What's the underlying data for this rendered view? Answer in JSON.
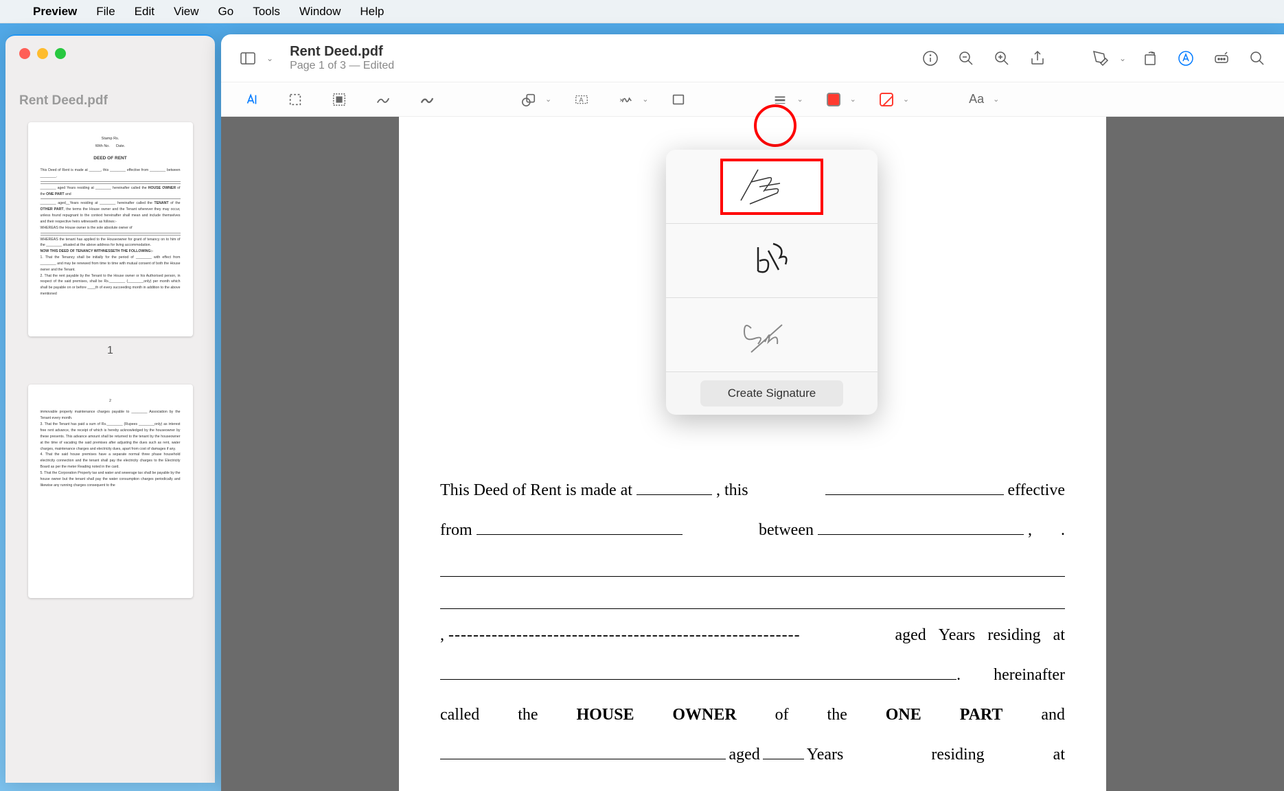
{
  "menubar": {
    "app": "Preview",
    "items": [
      "File",
      "Edit",
      "View",
      "Go",
      "Tools",
      "Window",
      "Help"
    ]
  },
  "sidebar": {
    "filename": "Rent Deed.pdf",
    "page_label_1": "1"
  },
  "toolbar": {
    "title": "Rent Deed.pdf",
    "subtitle": "Page 1 of 3 — Edited"
  },
  "signature_popover": {
    "create_label": "Create Signature"
  },
  "markup": {
    "font_label": "Aa"
  },
  "document": {
    "line1_a": "This Deed of Rent is made at",
    "line1_b": ", this",
    "line1_c": "effective",
    "line2_a": "from",
    "line2_b": "between",
    "line2_c": ",",
    "line2_d": ".",
    "line3_a": ",",
    "line3_dashes": "---------------------------------------------------------",
    "line3_b": "aged",
    "line3_c": "Years",
    "line3_d": "residing",
    "line3_e": "at",
    "line4_a": ".",
    "line4_b": "hereinafter",
    "line5_a": "called",
    "line5_b": "the",
    "line5_c": "HOUSE",
    "line5_d": "OWNER",
    "line5_e": "of",
    "line5_f": "the",
    "line5_g": "ONE",
    "line5_h": "PART",
    "line5_i": "and",
    "line6_a": "aged",
    "line6_b": "Years",
    "line6_c": "residing",
    "line6_d": "at"
  }
}
